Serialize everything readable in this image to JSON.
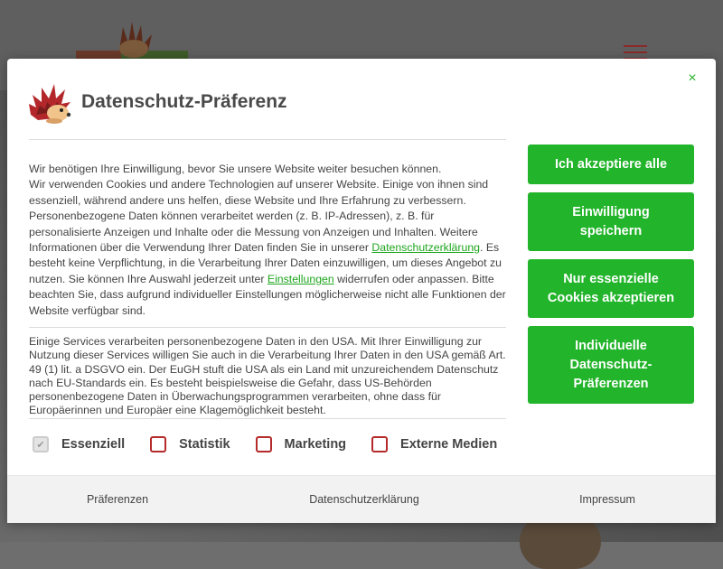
{
  "modal": {
    "title": "Datenschutz-Präferenz",
    "close_symbol": "×",
    "intro": {
      "part1": "Wir benötigen Ihre Einwilligung, bevor Sie unsere Website weiter besuchen können.\nWir verwenden Cookies und andere Technologien auf unserer Website. Einige von ihnen sind essenziell, während andere uns helfen, diese Website und Ihre Erfahrung zu verbessern. Personenbezogene Daten können verarbeitet werden (z. B. IP-Adressen), z. B. für personalisierte Anzeigen und Inhalte oder die Messung von Anzeigen und Inhalten. Weitere Informationen über die Verwendung Ihrer Daten finden Sie in unserer ",
      "link1": "Datenschutzerklärung",
      "part2": ". Es besteht keine Verpflichtung, in die Verarbeitung Ihrer Daten einzuwilligen, um dieses Angebot zu nutzen. Sie können Ihre Auswahl jederzeit unter ",
      "link2": "Einstellungen",
      "part3": " widerrufen oder anpassen. Bitte beachten Sie, dass aufgrund individueller Einstellungen möglicherweise nicht alle Funktionen der Website verfügbar sind."
    },
    "usa_notice": "Einige Services verarbeiten personenbezogene Daten in den USA. Mit Ihrer Einwilligung zur Nutzung dieser Services willigen Sie auch in die Verarbeitung Ihrer Daten in den USA gemäß Art. 49 (1) lit. a DSGVO ein. Der EuGH stuft die USA als ein Land mit unzureichendem Datenschutz nach EU-Standards ein. Es besteht beispielsweise die Gefahr, dass US-Behörden personenbezogene Daten in Überwachungsprogrammen verarbeiten, ohne dass für Europäerinnen und Europäer eine Klagemöglichkeit besteht.",
    "buttons": {
      "accept_all": "Ich akzeptiere alle",
      "save": "Einwilligung speichern",
      "essential_only": "Nur essenzielle Cookies akzeptieren",
      "individual": "Individuelle Datenschutz-Präferenzen"
    },
    "checkboxes": [
      {
        "label": "Essenziell",
        "checked": true,
        "disabled": true
      },
      {
        "label": "Statistik",
        "checked": false
      },
      {
        "label": "Marketing",
        "checked": false
      },
      {
        "label": "Externe Medien",
        "checked": false
      }
    ],
    "footer": {
      "preferences": "Präferenzen",
      "privacy": "Datenschutzerklärung",
      "imprint": "Impressum"
    }
  },
  "colors": {
    "accent": "#22b42a",
    "checkbox_border": "#b52a2a",
    "link": "#1da51d"
  },
  "icons": {
    "close": "close-icon",
    "mascot": "hedgehog-mascot-icon",
    "check": "check-icon",
    "menu": "hamburger-menu-icon"
  }
}
